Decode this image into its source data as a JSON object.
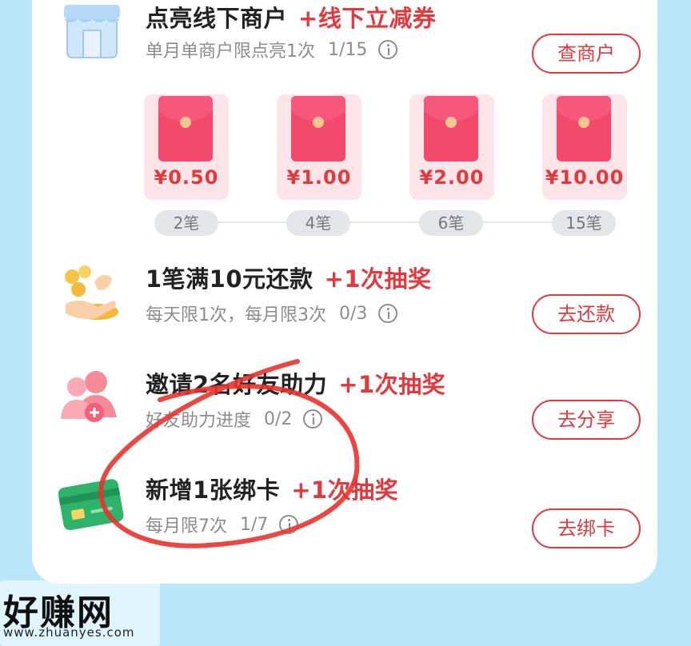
{
  "watermark": {
    "logo": "好赚网",
    "url": "www.zhuanyes.com"
  },
  "tasks": [
    {
      "icon": "shop-icon",
      "title": "点亮线下商户",
      "reward": "+线下立减券",
      "subtitle": "单月单商户限点亮1次",
      "progress": "1/15",
      "button": "查商户"
    },
    {
      "icon": "coins-hand-icon",
      "title": "1笔满10元还款",
      "reward": "+1次抽奖",
      "subtitle": "每天限1次，每月限3次",
      "progress": "0/3",
      "button": "去还款"
    },
    {
      "icon": "invite-user-icon",
      "title": "邀请2名好友助力",
      "reward": "+1次抽奖",
      "subtitle": "好友助力进度",
      "progress": "0/2",
      "button": "去分享"
    },
    {
      "icon": "bank-card-icon",
      "title": "新增1张绑卡",
      "reward": "+1次抽奖",
      "subtitle": "每月限7次",
      "progress": "1/7",
      "button": "去绑卡"
    }
  ],
  "red_packets": [
    {
      "amount": "¥0.50",
      "steps": "2笔"
    },
    {
      "amount": "¥1.00",
      "steps": "4笔"
    },
    {
      "amount": "¥2.00",
      "steps": "6笔"
    },
    {
      "amount": "¥10.00",
      "steps": "15笔"
    }
  ],
  "colors": {
    "accent": "#e0393e",
    "background": "#b9e6f8",
    "packet": "#f14a6a"
  }
}
